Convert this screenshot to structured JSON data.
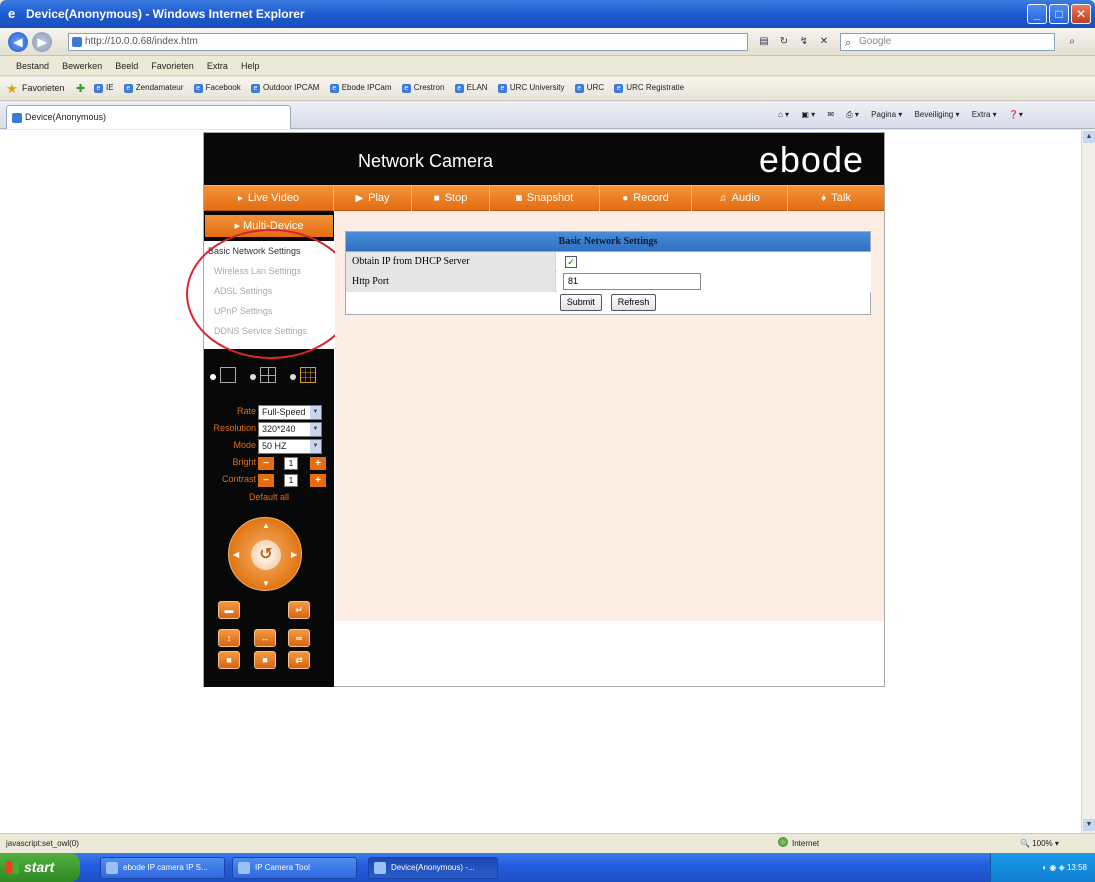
{
  "window": {
    "title": "Device(Anonymous) - Windows Internet Explorer"
  },
  "address": {
    "url": "http://10.0.0.68/index.htm",
    "search_placeholder": "Google"
  },
  "menu": [
    "Bestand",
    "Bewerken",
    "Beeld",
    "Favorieten",
    "Extra",
    "Help"
  ],
  "favorites": {
    "label": "Favorieten",
    "links": [
      "IE",
      "Zendamateur",
      "Facebook",
      "Outdoor IPCAM",
      "Ebode IPCam",
      "Crestron",
      "ELAN",
      "URC University",
      "URC",
      "URC Registratie"
    ]
  },
  "tab": {
    "label": "Device(Anonymous)"
  },
  "commandbar": [
    "Pagina ▾",
    "Beveiliging ▾",
    "Extra ▾"
  ],
  "camera": {
    "title": "Network Camera",
    "logo": "ebode",
    "toolbar": [
      {
        "label": "Live Video",
        "icon": "▸"
      },
      {
        "label": "Play",
        "icon": "▶"
      },
      {
        "label": "Stop",
        "icon": "■"
      },
      {
        "label": "Snapshot",
        "icon": "◙"
      },
      {
        "label": "Record",
        "icon": "●"
      },
      {
        "label": "Audio",
        "icon": "♫"
      },
      {
        "label": "Talk",
        "icon": "♦"
      }
    ],
    "multi_device": "Multi-Device",
    "menu_items": [
      "Basic Network Settings",
      "Wireless Lan Settings",
      "ADSL Settings",
      "UPnP Settings",
      "DDNS Service Settings"
    ],
    "controls": {
      "rate_label": "Rate",
      "rate_value": "Full-Speed",
      "resolution_label": "Resolution",
      "resolution_value": "320*240",
      "mode_label": "Mode",
      "mode_value": "50 HZ",
      "bright_label": "Bright",
      "bright_value": "1",
      "contrast_label": "Contrast",
      "contrast_value": "1",
      "default_all": "Default all"
    },
    "settings": {
      "heading": "Basic Network Settings",
      "dhcp_label": "Obtain IP from DHCP Server",
      "dhcp_checked": "☑",
      "port_label": "Http Port",
      "port_value": "81",
      "submit": "Submit",
      "refresh": "Refresh"
    }
  },
  "status": {
    "left": "javascript:set_owl(0)",
    "zone": "Internet",
    "zoom": "100%"
  },
  "taskbar": {
    "start": "start",
    "tasks": [
      "ebode IP camera IP S...",
      "IP Camera Tool",
      "Device(Anonymous) -..."
    ],
    "clock": "13:58"
  }
}
